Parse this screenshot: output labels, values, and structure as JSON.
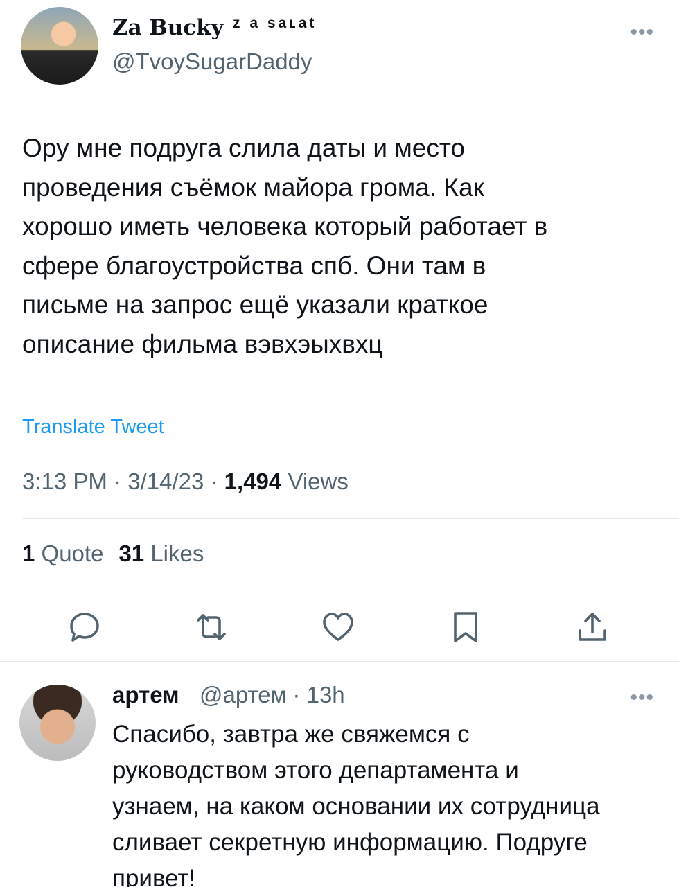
{
  "tweet": {
    "author": {
      "display_name": "Za Bucky",
      "name_suffix": "z a ѕaʟat",
      "handle": "@TvoySugarDaddy"
    },
    "text": "Ору мне подруга слила даты и место\nпроведения съёмок майора грома. Как\nхорошо иметь человека который работает в\nсфере благоустройства спб. Они там в\nписьме на запрос ещё указали краткое\nописание фильма вэвхэыхвхц",
    "translate_label": "Translate Tweet",
    "time": "3:13 PM",
    "date": "3/14/23",
    "views_count": "1,494",
    "views_label": "Views",
    "quotes_count": "1",
    "quotes_label": "Quote",
    "likes_count": "31",
    "likes_label": "Likes",
    "more_icon": "more-horizontal-icon"
  },
  "actions": [
    "reply-icon",
    "retweet-icon",
    "like-icon",
    "bookmark-icon",
    "share-icon"
  ],
  "reply": {
    "author": {
      "display_name": "артем",
      "handle": "@артем",
      "time": "13h"
    },
    "text": "Спасибо, завтра же свяжемся с\nруководством этого департамента и\nузнаем, на каком основании их сотрудница\nсливает секретную информацию. Подруге\nпривет!"
  },
  "colors": {
    "text": "#0f1419",
    "secondary": "#536471",
    "link": "#1d9bf0",
    "divider": "#e7e9ea"
  }
}
